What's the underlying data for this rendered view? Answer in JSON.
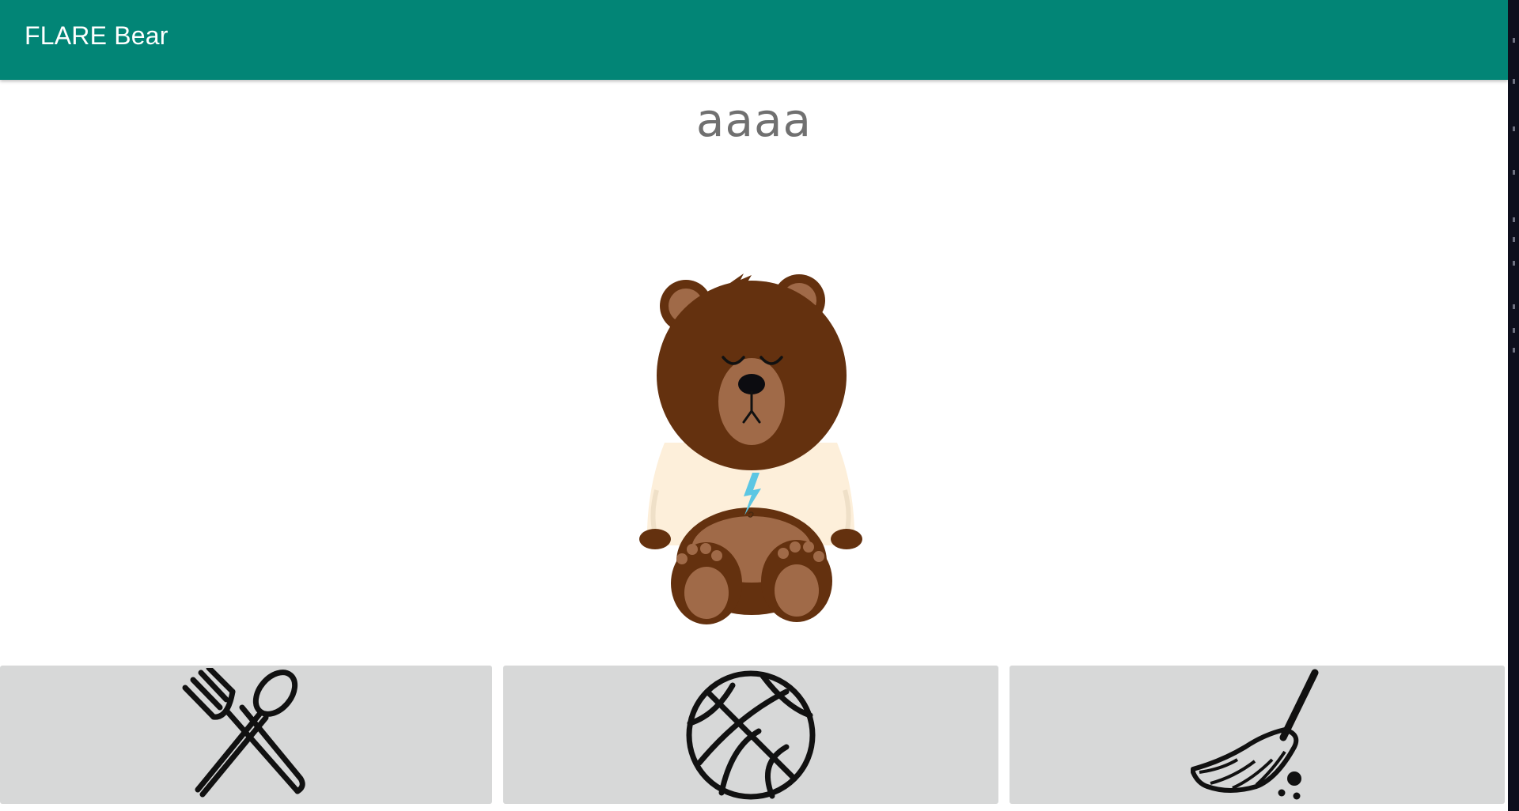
{
  "app": {
    "title": "FLARE Bear",
    "header_color": "#028576"
  },
  "bear": {
    "name": "aaaa",
    "state": "sleeping"
  },
  "actions": [
    {
      "name": "feed",
      "icon": "fork-spoon-icon"
    },
    {
      "name": "play",
      "icon": "basketball-icon"
    },
    {
      "name": "clean",
      "icon": "broom-icon"
    }
  ]
}
